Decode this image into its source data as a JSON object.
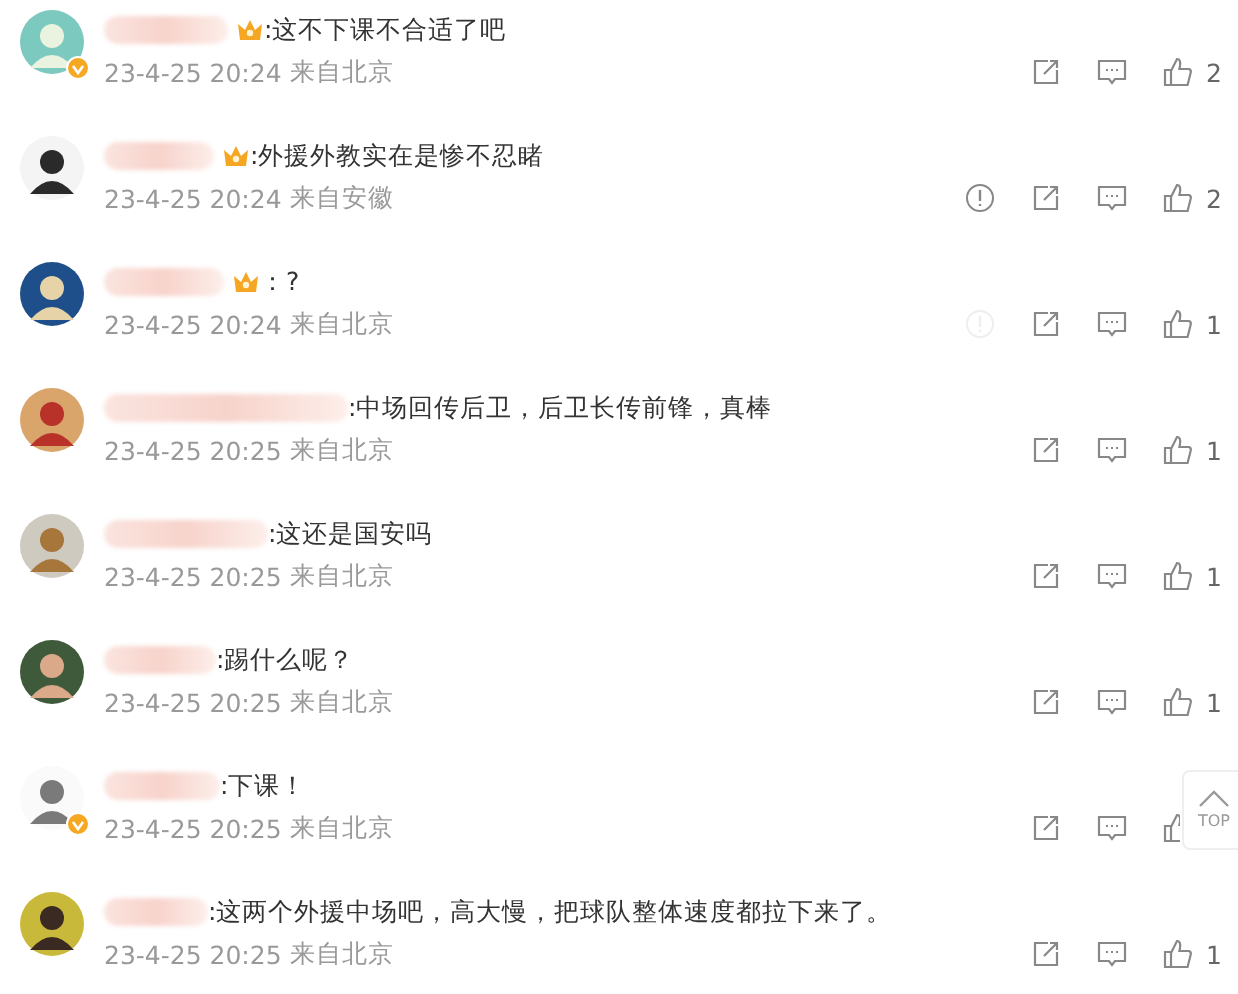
{
  "comments": [
    {
      "crown_badge": true,
      "verified": true,
      "text": ":这不下课不合适了吧",
      "time": "23-4-25 20:24",
      "source": "来自北京",
      "report_icon": false,
      "likes": "2"
    },
    {
      "crown_badge": true,
      "verified": false,
      "text": ":外援外教实在是惨不忍睹",
      "time": "23-4-25 20:24",
      "source": "来自安徽",
      "report_icon": true,
      "report_faded": false,
      "likes": "2"
    },
    {
      "crown_badge": true,
      "verified": false,
      "text": "：?",
      "time": "23-4-25 20:24",
      "source": "来自北京",
      "report_icon": true,
      "report_faded": true,
      "likes": "1"
    },
    {
      "crown_badge": false,
      "verified": false,
      "text": ":中场回传后卫，后卫长传前锋，真棒",
      "time": "23-4-25 20:25",
      "source": "来自北京",
      "report_icon": false,
      "likes": "1"
    },
    {
      "crown_badge": false,
      "verified": false,
      "text": ":这还是国安吗",
      "time": "23-4-25 20:25",
      "source": "来自北京",
      "report_icon": false,
      "likes": "1"
    },
    {
      "crown_badge": false,
      "verified": false,
      "text": ":踢什么呢？",
      "time": "23-4-25 20:25",
      "source": "来自北京",
      "report_icon": false,
      "likes": "1"
    },
    {
      "crown_badge": false,
      "verified": true,
      "text": ":下课！",
      "time": "23-4-25 20:25",
      "source": "来自北京",
      "report_icon": false
    },
    {
      "crown_badge": false,
      "verified": false,
      "text": ":这两个外援中场吧，高大慢，把球队整体速度都拉下来了。",
      "time": "23-4-25 20:25",
      "source": "来自北京",
      "report_icon": false,
      "likes": "1"
    }
  ],
  "top_button": {
    "label": "TOP"
  }
}
